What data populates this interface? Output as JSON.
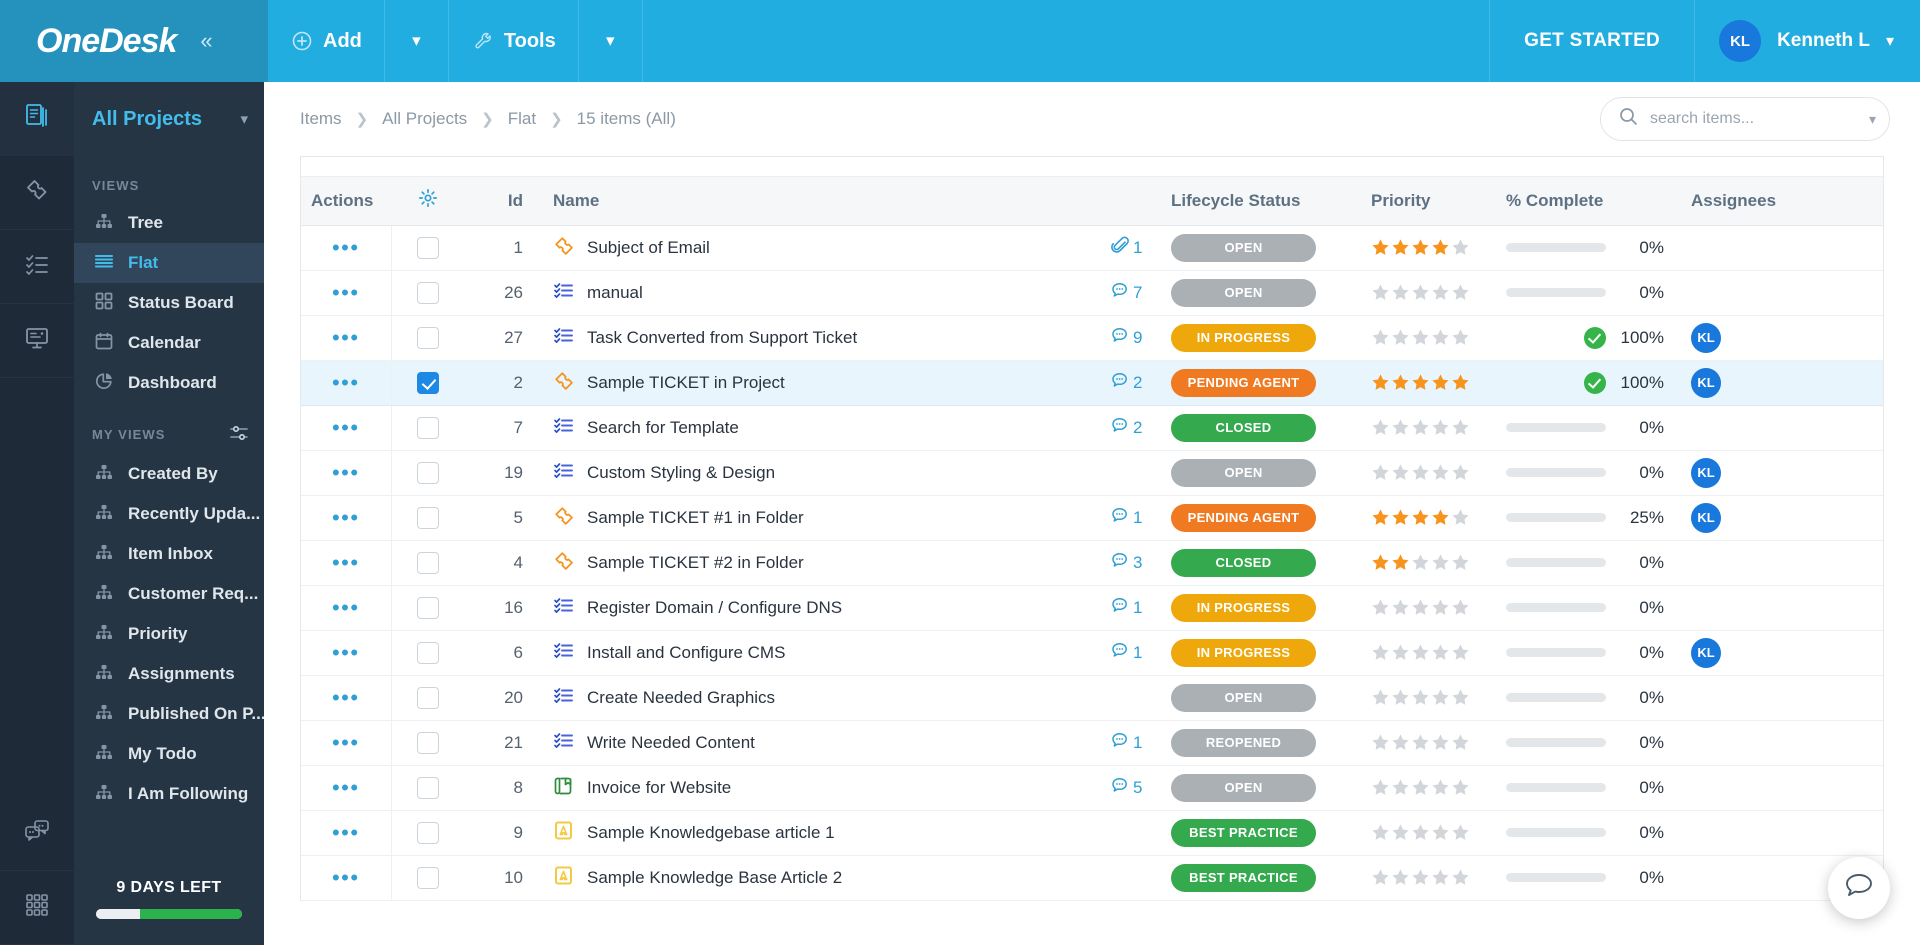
{
  "topbar": {
    "logo": "OneDesk",
    "collapse_icon": "double-chevron-left-icon",
    "add_label": "Add",
    "tools_label": "Tools",
    "get_started_label": "GET STARTED",
    "user_initials": "KL",
    "user_name": "Kenneth L"
  },
  "sidebar": {
    "project_selector": "All Projects",
    "rail": [
      {
        "name": "projects-icon"
      },
      {
        "name": "tickets-icon"
      },
      {
        "name": "tasks-icon"
      },
      {
        "name": "knowledgebase-icon"
      },
      {
        "name": "chat-icon"
      },
      {
        "name": "apps-grid-icon"
      }
    ],
    "views_header": "VIEWS",
    "views": [
      {
        "label": "Tree",
        "icon": "hierarchy-icon",
        "active": false
      },
      {
        "label": "Flat",
        "icon": "list-flat-icon",
        "active": true
      },
      {
        "label": "Status Board",
        "icon": "grid-board-icon",
        "active": false
      },
      {
        "label": "Calendar",
        "icon": "calendar-icon",
        "active": false
      },
      {
        "label": "Dashboard",
        "icon": "pie-chart-icon",
        "active": false
      }
    ],
    "my_views_header": "MY VIEWS",
    "my_views": [
      {
        "label": "Created By",
        "icon": "hierarchy-icon"
      },
      {
        "label": "Recently Upda...",
        "icon": "hierarchy-icon"
      },
      {
        "label": "Item Inbox",
        "icon": "hierarchy-icon"
      },
      {
        "label": "Customer Req...",
        "icon": "hierarchy-icon"
      },
      {
        "label": "Priority",
        "icon": "hierarchy-icon"
      },
      {
        "label": "Assignments",
        "icon": "hierarchy-icon"
      },
      {
        "label": "Published On P...",
        "icon": "hierarchy-icon"
      },
      {
        "label": "My Todo",
        "icon": "hierarchy-icon"
      },
      {
        "label": "I Am Following",
        "icon": "hierarchy-icon"
      }
    ],
    "trial_label": "9 DAYS LEFT",
    "trial_percent": 70
  },
  "breadcrumb": [
    "Items",
    "All Projects",
    "Flat",
    "15 items (All)"
  ],
  "search": {
    "placeholder": "search items...",
    "value": ""
  },
  "table": {
    "columns": [
      "Actions",
      "",
      "Id",
      "Name",
      "",
      "Lifecycle Status",
      "Priority",
      "% Complete",
      "Assignees"
    ],
    "gear_icon": "gear-icon",
    "rows": [
      {
        "id": "1",
        "name": "Subject of Email",
        "type": "ticket",
        "comments": "1",
        "comment_icon": "paperclip-icon",
        "status": "OPEN",
        "status_class": "b-open",
        "stars": 4,
        "percent": 0,
        "assignee": "",
        "checked": false
      },
      {
        "id": "26",
        "name": "manual",
        "type": "task",
        "comments": "7",
        "comment_icon": "comment-icon",
        "status": "OPEN",
        "status_class": "b-open",
        "stars": 0,
        "percent": 0,
        "assignee": "",
        "checked": false
      },
      {
        "id": "27",
        "name": "Task Converted from Support Ticket",
        "type": "task",
        "comments": "9",
        "comment_icon": "comment-icon",
        "status": "IN PROGRESS",
        "status_class": "b-prog",
        "stars": 0,
        "percent": 100,
        "assignee": "KL",
        "checked": false
      },
      {
        "id": "2",
        "name": "Sample TICKET in Project",
        "type": "ticket",
        "comments": "2",
        "comment_icon": "comment-icon",
        "status": "PENDING AGENT",
        "status_class": "b-pend",
        "stars": 5,
        "percent": 100,
        "assignee": "KL",
        "checked": true
      },
      {
        "id": "7",
        "name": "Search for Template",
        "type": "task",
        "comments": "2",
        "comment_icon": "comment-icon",
        "status": "CLOSED",
        "status_class": "b-closed",
        "stars": 0,
        "percent": 0,
        "assignee": "",
        "checked": false
      },
      {
        "id": "19",
        "name": "Custom Styling & Design",
        "type": "task",
        "comments": "",
        "comment_icon": "",
        "status": "OPEN",
        "status_class": "b-open",
        "stars": 0,
        "percent": 0,
        "assignee": "KL",
        "checked": false
      },
      {
        "id": "5",
        "name": "Sample TICKET #1 in Folder",
        "type": "ticket",
        "comments": "1",
        "comment_icon": "comment-icon",
        "status": "PENDING AGENT",
        "status_class": "b-pend",
        "stars": 4,
        "percent": 25,
        "assignee": "KL",
        "checked": false
      },
      {
        "id": "4",
        "name": "Sample TICKET #2 in Folder",
        "type": "ticket",
        "comments": "3",
        "comment_icon": "comment-icon",
        "status": "CLOSED",
        "status_class": "b-closed",
        "stars": 2,
        "percent": 0,
        "assignee": "",
        "checked": false
      },
      {
        "id": "16",
        "name": "Register Domain / Configure DNS",
        "type": "task",
        "comments": "1",
        "comment_icon": "comment-icon",
        "status": "IN PROGRESS",
        "status_class": "b-prog",
        "stars": 0,
        "percent": 0,
        "assignee": "",
        "checked": false
      },
      {
        "id": "6",
        "name": "Install and Configure CMS",
        "type": "task",
        "comments": "1",
        "comment_icon": "comment-icon",
        "status": "IN PROGRESS",
        "status_class": "b-prog",
        "stars": 0,
        "percent": 0,
        "assignee": "KL",
        "checked": false
      },
      {
        "id": "20",
        "name": "Create Needed Graphics",
        "type": "task",
        "comments": "",
        "comment_icon": "",
        "status": "OPEN",
        "status_class": "b-open",
        "stars": 0,
        "percent": 0,
        "assignee": "",
        "checked": false
      },
      {
        "id": "21",
        "name": "Write Needed Content",
        "type": "task",
        "comments": "1",
        "comment_icon": "comment-icon",
        "status": "REOPENED",
        "status_class": "b-reop",
        "stars": 0,
        "percent": 0,
        "assignee": "",
        "checked": false
      },
      {
        "id": "8",
        "name": "Invoice for Website",
        "type": "invoice",
        "comments": "5",
        "comment_icon": "comment-icon",
        "status": "OPEN",
        "status_class": "b-open",
        "stars": 0,
        "percent": 0,
        "assignee": "",
        "checked": false
      },
      {
        "id": "9",
        "name": "Sample Knowledgebase article 1",
        "type": "article",
        "comments": "",
        "comment_icon": "",
        "status": "BEST PRACTICE",
        "status_class": "b-best",
        "stars": 0,
        "percent": 0,
        "assignee": "",
        "checked": false
      },
      {
        "id": "10",
        "name": "Sample Knowledge Base Article 2",
        "type": "article",
        "comments": "",
        "comment_icon": "",
        "status": "BEST PRACTICE",
        "status_class": "b-best",
        "stars": 0,
        "percent": 0,
        "assignee": "",
        "checked": false
      }
    ]
  },
  "chat_fab_icon": "chat-bubble-icon",
  "colors": {
    "brand_blue": "#21ADDF",
    "brand_blue_dark": "#2591BD",
    "sidebar_dark": "#263544",
    "rail_dark": "#1E2A38",
    "accent_cyan": "#43BCEC",
    "star_orange": "#F7941E",
    "green": "#35A94D",
    "amber": "#EFA80B",
    "orange": "#F07A21",
    "grey_badge": "#aab0b4",
    "avatar_blue": "#1878DB"
  }
}
